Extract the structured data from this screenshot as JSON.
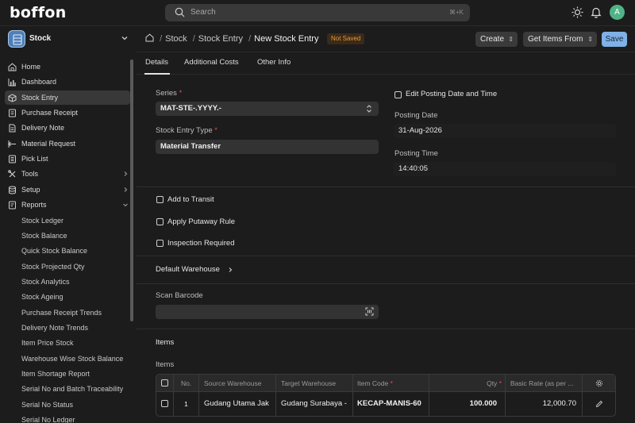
{
  "app": {
    "logo": "boffon",
    "search_placeholder": "Search",
    "search_shortcut": "⌘+K",
    "avatar_initial": "A"
  },
  "sidebar": {
    "workspace": "Stock",
    "items": [
      {
        "label": "Home",
        "icon": "home-icon"
      },
      {
        "label": "Dashboard",
        "icon": "bar-chart-icon"
      },
      {
        "label": "Stock Entry",
        "icon": "box-icon",
        "active": true
      },
      {
        "label": "Purchase Receipt",
        "icon": "receipt-icon"
      },
      {
        "label": "Delivery Note",
        "icon": "document-icon"
      },
      {
        "label": "Material Request",
        "icon": "arrows-icon"
      },
      {
        "label": "Pick List",
        "icon": "list-icon"
      },
      {
        "label": "Tools",
        "icon": "tools-icon"
      },
      {
        "label": "Setup",
        "icon": "database-icon"
      },
      {
        "label": "Reports",
        "icon": "reports-icon"
      }
    ],
    "reports": [
      "Stock Ledger",
      "Stock Balance",
      "Quick Stock Balance",
      "Stock Projected Qty",
      "Stock Analytics",
      "Stock Ageing",
      "Purchase Receipt Trends",
      "Delivery Note Trends",
      "Item Price Stock",
      "Warehouse Wise Stock Balance",
      "Item Shortage Report",
      "Serial No and Batch Traceability",
      "Serial No Status",
      "Serial No Ledger"
    ]
  },
  "header": {
    "breadcrumbs": [
      "Stock",
      "Stock Entry"
    ],
    "title": "New Stock Entry",
    "status": "Not Saved",
    "create_label": "Create",
    "get_items_label": "Get Items From",
    "save_label": "Save"
  },
  "tabs": [
    "Details",
    "Additional Costs",
    "Other Info"
  ],
  "form": {
    "series_label": "Series",
    "series_value": "MAT-STE-.YYYY.-",
    "stock_entry_type_label": "Stock Entry Type",
    "stock_entry_type_value": "Material Transfer",
    "edit_posting_label": "Edit Posting Date and Time",
    "posting_date_label": "Posting Date",
    "posting_date_value": "31-Aug-2026",
    "posting_time_label": "Posting Time",
    "posting_time_value": "14:40:05",
    "add_to_transit_label": "Add to Transit",
    "apply_putaway_label": "Apply Putaway Rule",
    "inspection_label": "Inspection Required",
    "default_warehouse_label": "Default Warehouse",
    "scan_barcode_label": "Scan Barcode",
    "items_section_label": "Items",
    "items_table_label": "Items"
  },
  "items_table": {
    "columns": [
      "No.",
      "Source Warehouse",
      "Target Warehouse",
      "Item Code",
      "Qty",
      "Basic Rate (as per ..."
    ],
    "rows": [
      {
        "no": "1",
        "source": "Gudang Utama Jak",
        "target": "Gudang Surabaya -",
        "item_code": "KECAP-MANIS-60",
        "qty": "100.000",
        "rate": "12,000.70"
      }
    ]
  },
  "colors": {
    "accent": "#7fb0e6",
    "warning": "#e69a3c",
    "avatar": "#4fb386"
  }
}
